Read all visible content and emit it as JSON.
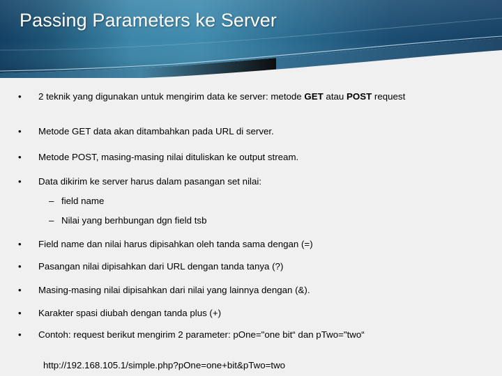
{
  "slide": {
    "title": "Passing Parameters ke Server",
    "theme": {
      "banner_dark": "#15466c",
      "banner_mid": "#3d88ac",
      "banner_deep": "#1b4b70",
      "banner_band": "#2f7295",
      "hairline": "#bcd6e4",
      "background": "#f0f0f0",
      "title_color": "#ffffff",
      "text_color": "#000000"
    },
    "markers": {
      "bullet": "•",
      "subbullet": "–"
    },
    "content": [
      {
        "kind": "bullet",
        "marker": "•",
        "justify": false,
        "runs": [
          {
            "text": "2 teknik yang digunakan untuk mengirim data ke server: metode ",
            "bold": false
          },
          {
            "text": "GET",
            "bold": true
          },
          {
            "text": " atau ",
            "bold": false
          },
          {
            "text": "POST",
            "bold": true
          },
          {
            "text": " request",
            "bold": false
          }
        ]
      },
      {
        "kind": "bullet",
        "marker": "•",
        "justify": false,
        "runs": [
          {
            "text": "Metode GET data akan ditambahkan pada URL di server.",
            "bold": false
          }
        ]
      },
      {
        "kind": "bullet",
        "marker": "•",
        "justify": false,
        "runs": [
          {
            "text": "Metode POST, masing-masing nilai dituliskan ke output stream.",
            "bold": false
          }
        ]
      },
      {
        "kind": "bullet",
        "marker": "•",
        "justify": false,
        "runs": [
          {
            "text": "Data dikirim ke server harus dalam pasangan set nilai:",
            "bold": false
          }
        ]
      },
      {
        "kind": "subbullet",
        "marker": "–",
        "justify": false,
        "runs": [
          {
            "text": "field name",
            "bold": false
          }
        ]
      },
      {
        "kind": "subbullet",
        "marker": "–",
        "justify": false,
        "runs": [
          {
            "text": "Nilai yang berhbungan dgn field tsb",
            "bold": false
          }
        ]
      },
      {
        "kind": "bullet",
        "marker": "•",
        "justify": false,
        "runs": [
          {
            "text": "Field name dan nilai harus dipisahkan oleh tanda sama dengan (=)",
            "bold": false
          }
        ]
      },
      {
        "kind": "bullet",
        "marker": "•",
        "justify": false,
        "runs": [
          {
            "text": "Pasangan nilai dipisahkan dari URL dengan tanda tanya (?)",
            "bold": false
          }
        ]
      },
      {
        "kind": "bullet",
        "marker": "•",
        "justify": false,
        "runs": [
          {
            "text": "Masing-masing nilai dipisahkan dari nilai yang lainnya dengan (&).",
            "bold": false
          }
        ]
      },
      {
        "kind": "bullet",
        "marker": "•",
        "justify": false,
        "runs": [
          {
            "text": "Karakter spasi diubah dengan tanda plus (+)",
            "bold": false
          }
        ]
      },
      {
        "kind": "bullet",
        "marker": "•",
        "justify": true,
        "runs": [
          {
            "text": "Contoh: request berikut mengirim 2 parameter: pOne=\"one bit“ dan pTwo=\"two“",
            "bold": false
          }
        ]
      },
      {
        "kind": "plain",
        "marker": "",
        "justify": false,
        "runs": [
          {
            "text": "http://192.168.105.1/simple.php?pOne=one+bit&pTwo=two",
            "bold": false
          }
        ]
      }
    ]
  }
}
